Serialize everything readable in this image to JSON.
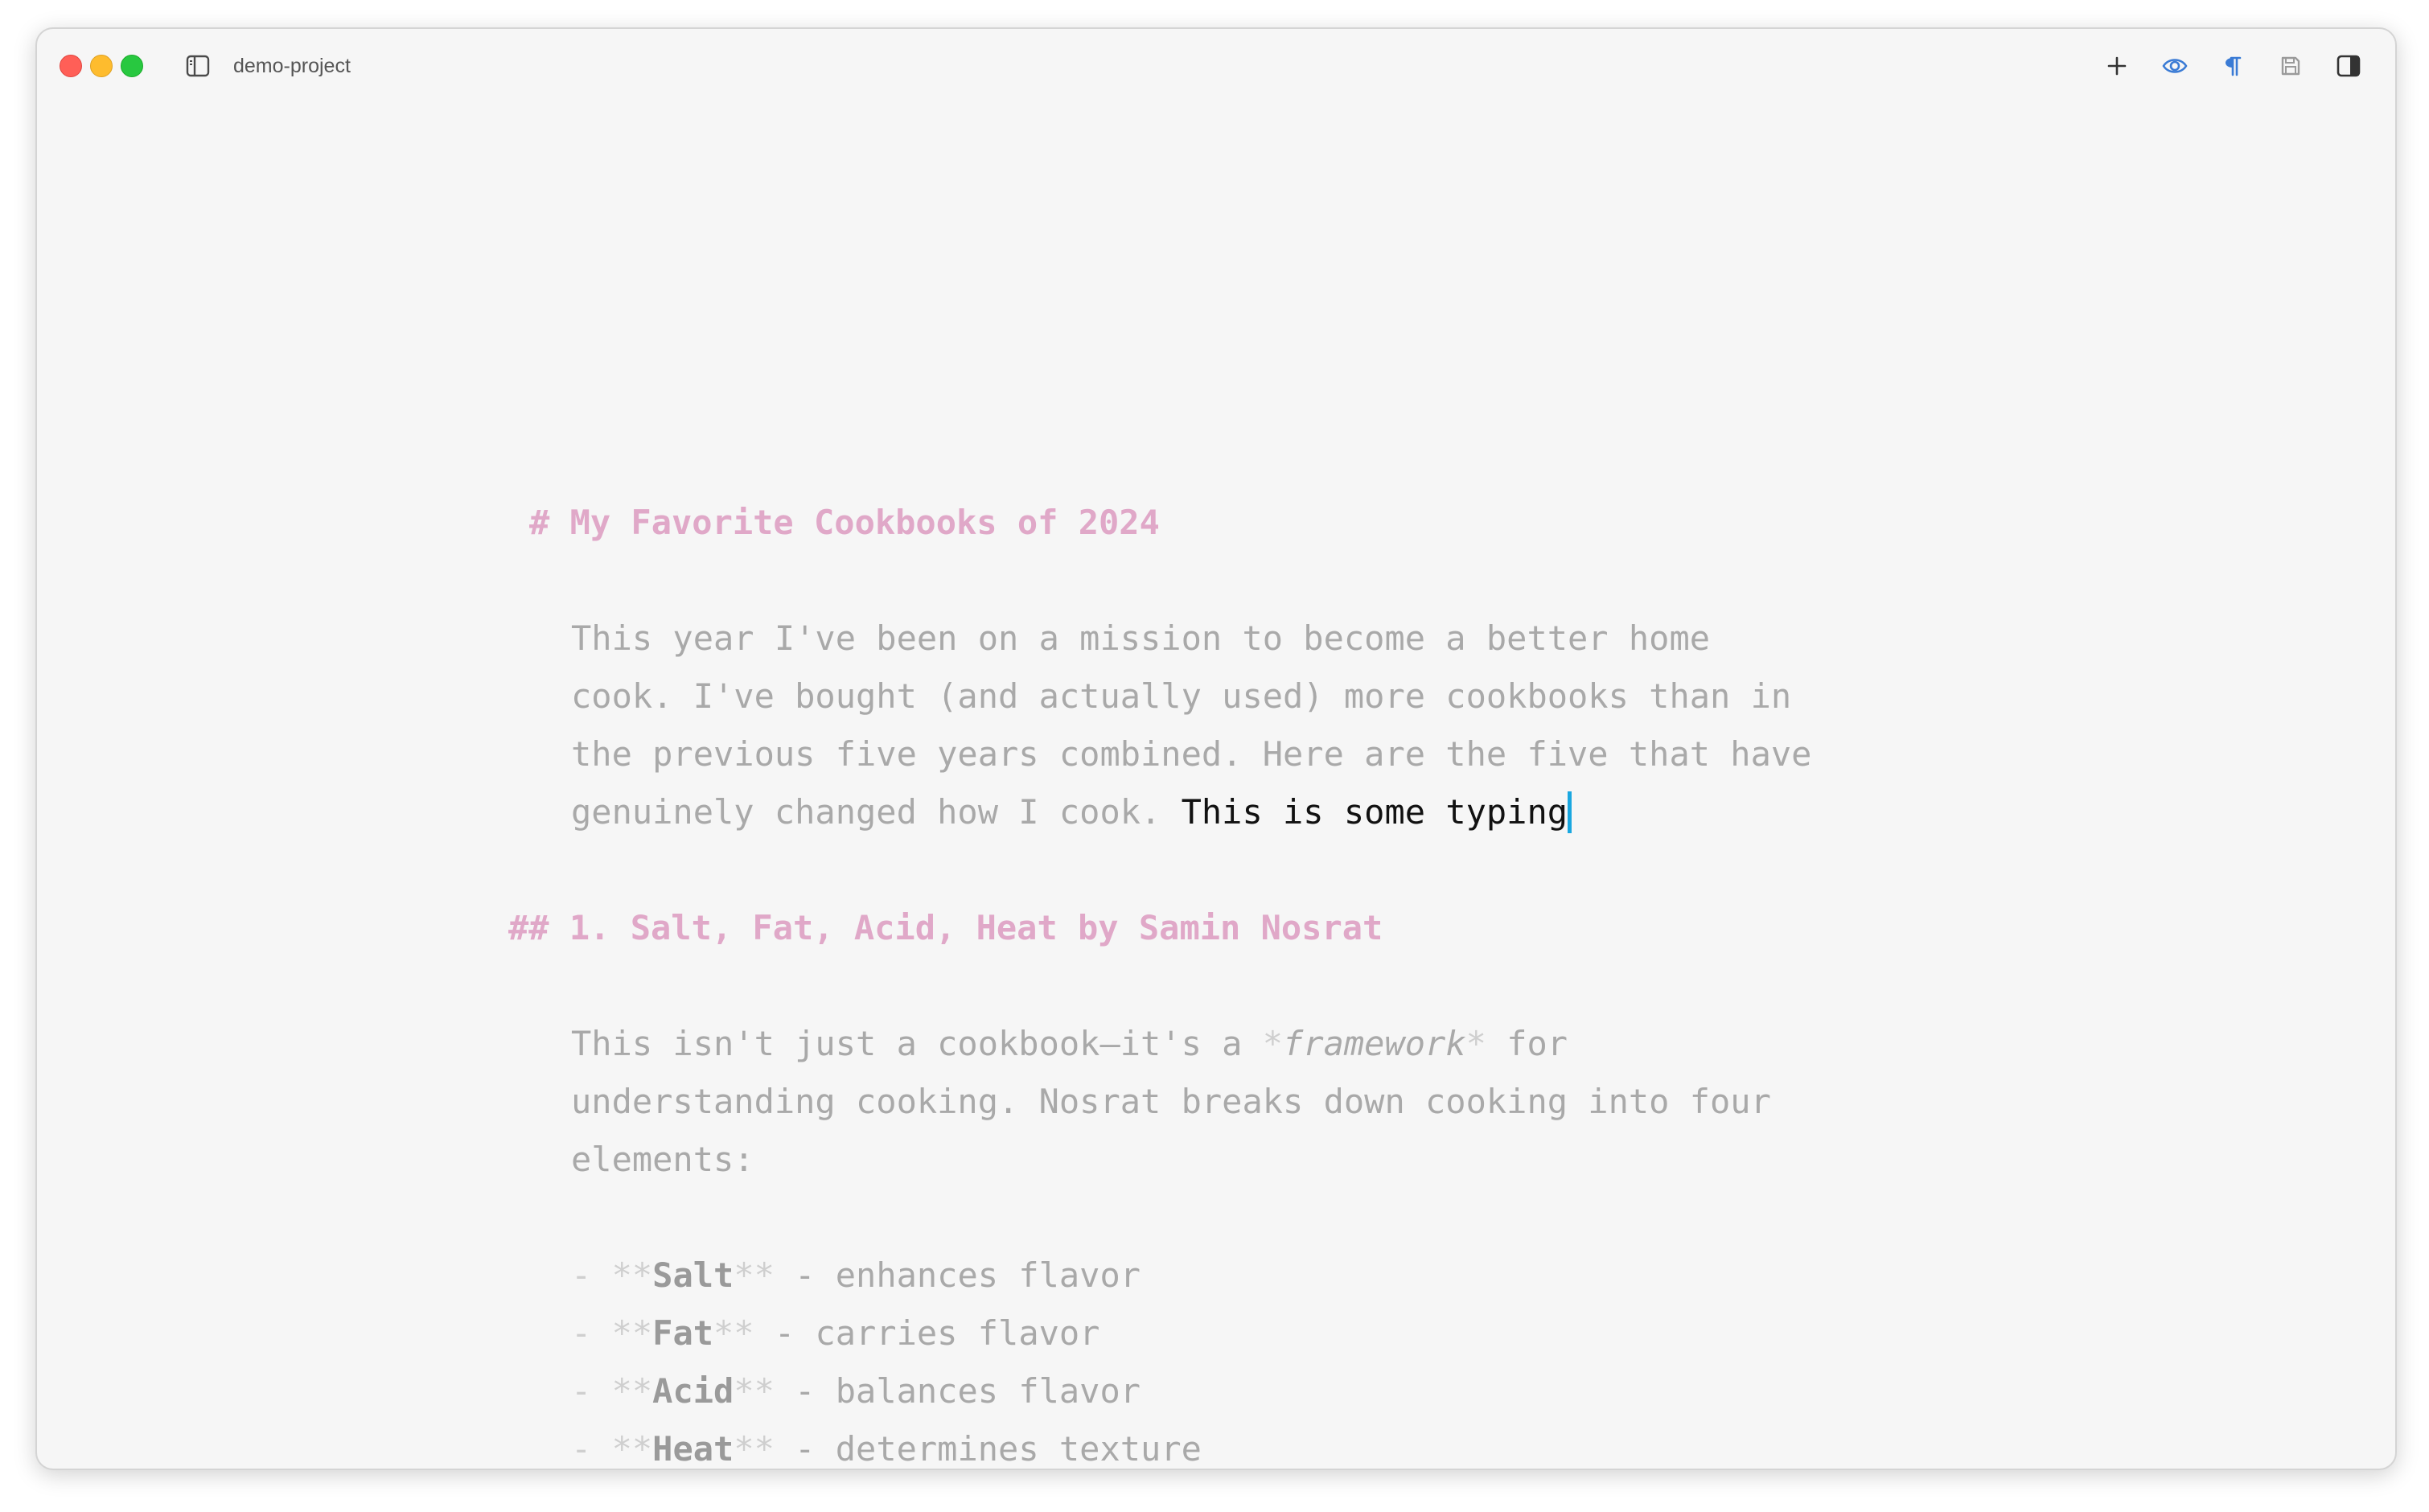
{
  "window": {
    "project_name": "demo-project"
  },
  "toolbar": {
    "icons": [
      "sidebar-toggle-icon",
      "plus-icon",
      "eye-icon",
      "pilcrow-icon",
      "save-icon",
      "panel-right-icon"
    ],
    "accent_color": "#3a7bd5"
  },
  "document": {
    "heading1": "# My Favorite Cookbooks of 2024",
    "intro_lines": [
      "This year I've been on a mission to become a better home",
      "cook. I've bought (and actually used) more cookbooks than in",
      "the previous five years combined. Here are the five that have",
      "genuinely changed how I cook. "
    ],
    "typed_text": "This is some typing",
    "heading2": "## 1. Salt, Fat, Acid, Heat by Samin Nosrat",
    "para2": {
      "line1_before": "This isn't just a cookbook—it's a ",
      "italic_marker_open": "*",
      "italic_word": "framework",
      "italic_marker_close": "*",
      "line1_after": " for",
      "line2": "understanding cooking. Nosrat breaks down cooking into four",
      "line3": "elements:"
    },
    "list": [
      {
        "dash": "- ",
        "open": "**",
        "word": "Salt",
        "close": "**",
        "rest": " - enhances flavor"
      },
      {
        "dash": "- ",
        "open": "**",
        "word": "Fat",
        "close": "**",
        "rest": " - carries flavor"
      },
      {
        "dash": "- ",
        "open": "**",
        "word": "Acid",
        "close": "**",
        "rest": " - balances flavor"
      },
      {
        "dash": "- ",
        "open": "**",
        "word": "Heat",
        "close": "**",
        "rest": " - determines texture"
      }
    ],
    "colors": {
      "heading": "#e0a8c8",
      "body": "#a9a9a9",
      "typed": "#111111",
      "cursor": "#1aa7e0"
    }
  }
}
